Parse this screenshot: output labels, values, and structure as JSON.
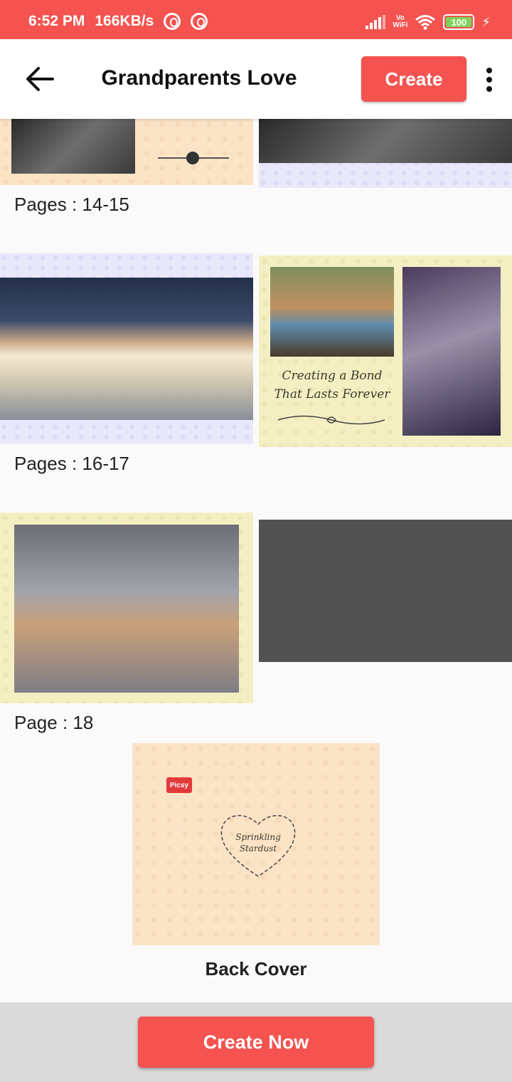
{
  "status_bar": {
    "time": "6:52 PM",
    "speed": "166KB/s",
    "vowifi_line1": "Vo",
    "vowifi_line2": "WiFi",
    "battery": "100"
  },
  "app_bar": {
    "title": "Grandparents Love",
    "create_label": "Create"
  },
  "pages": [
    {
      "label": "Pages : 14-15"
    },
    {
      "label": "Pages : 16-17",
      "card_text_line1": "Creating a Bond",
      "card_text_line2": "That Lasts Forever"
    },
    {
      "label": "Page : 18"
    }
  ],
  "back_cover": {
    "label": "Back Cover",
    "logo_text": "Picsy",
    "heart_text_line1": "Sprinkling",
    "heart_text_line2": "Stardust"
  },
  "bottom": {
    "create_now_label": "Create Now"
  },
  "colors": {
    "accent": "#f4534f"
  }
}
